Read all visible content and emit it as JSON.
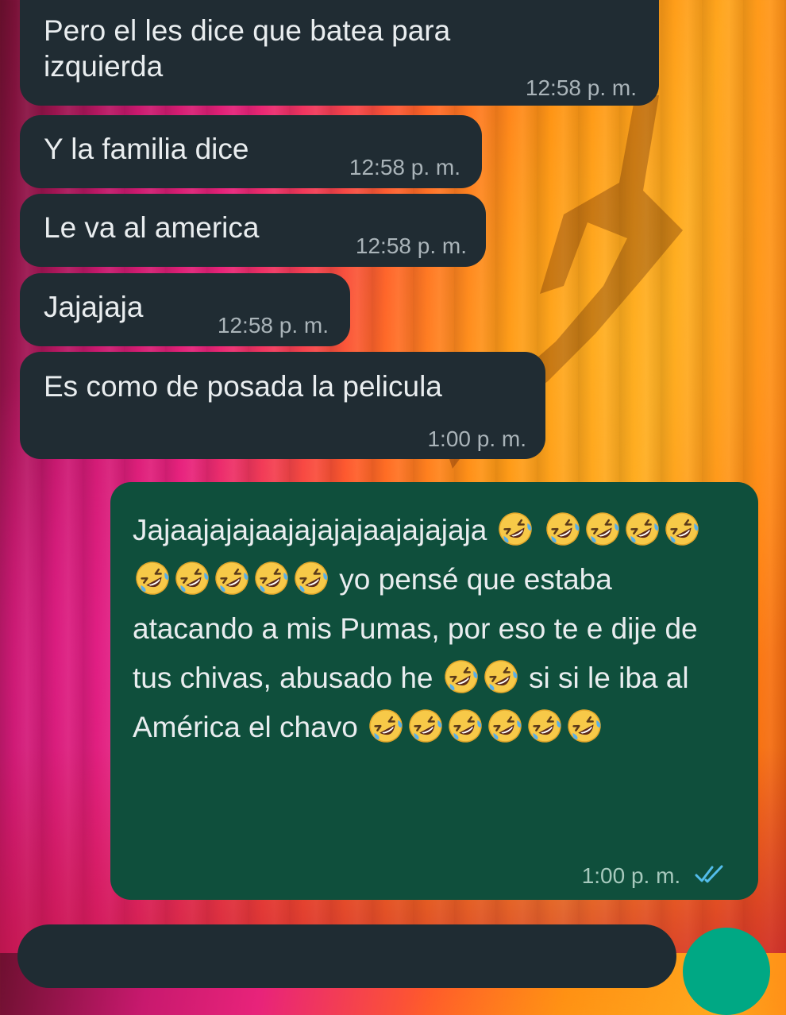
{
  "messages": [
    {
      "side": "incoming",
      "text": "Pero el les dice que batea para izquierda",
      "time": "12:58 p. m."
    },
    {
      "side": "incoming",
      "text": "Y la familia dice",
      "time": "12:58 p. m."
    },
    {
      "side": "incoming",
      "text": "Le va al america",
      "time": "12:58 p. m."
    },
    {
      "side": "incoming",
      "text": "Jajajaja",
      "time": "12:58 p. m."
    },
    {
      "side": "incoming",
      "text": "Es como de posada la pelicula",
      "time": "1:00 p. m."
    },
    {
      "side": "outgoing",
      "segments": [
        "Jajaajajajaajajajajaajajajaja",
        "yo pensé que estaba atacando a mis Pumas, por eso te e dije de tus chivas, abusado he",
        "si si le iba al América el chavo"
      ],
      "emoji_name": "rolling-on-the-floor-laughing",
      "emoji_counts": [
        10,
        2,
        6
      ],
      "time": "1:00 p. m.",
      "status": "read"
    }
  ],
  "colors": {
    "incoming_bubble": "#202c33",
    "outgoing_bubble": "#0f4f3c",
    "read_checks": "#53bdeb",
    "send_button": "#00a884"
  },
  "icons": {
    "read_receipt": "double-check-icon",
    "emoji": "rolling-laughing-emoji-icon"
  }
}
